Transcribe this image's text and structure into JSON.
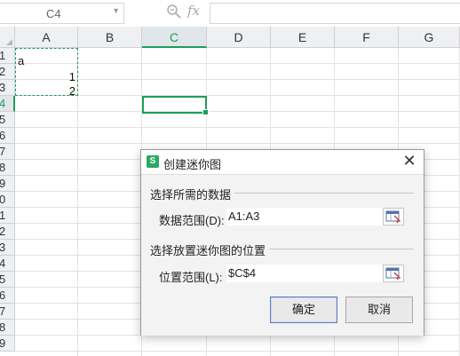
{
  "formula_bar": {
    "name_box": "C4",
    "fx_label": "fx",
    "formula": ""
  },
  "columns": [
    "A",
    "B",
    "C",
    "D",
    "E",
    "F",
    "G"
  ],
  "selected_column": "C",
  "rows": [
    "1",
    "2",
    "3",
    "4",
    "5",
    "6",
    "7",
    "8",
    "9",
    "0",
    "1",
    "2",
    "3",
    "4",
    "5",
    "6",
    "7",
    "8",
    "9"
  ],
  "selected_row_index": 3,
  "cells": {
    "A1": "a",
    "A2": "1",
    "A3": "2"
  },
  "dialog": {
    "title": "创建迷你图",
    "app_icon": "S",
    "data_section": "选择所需的数据",
    "data_range_label": "数据范围(D):",
    "data_range_value": "A1:A3",
    "location_section": "选择放置迷你图的位置",
    "location_range_label": "位置范围(L):",
    "location_range_value": "$C$4",
    "ok_label": "确定",
    "cancel_label": "取消"
  },
  "colors": {
    "accent": "#1e9c5a",
    "header_bg": "#eef0f3"
  }
}
